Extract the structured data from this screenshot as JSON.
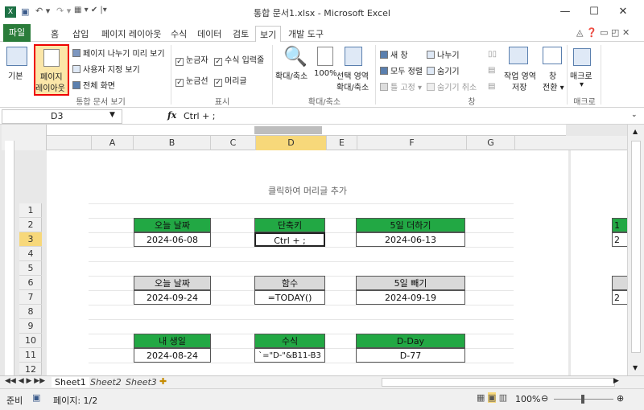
{
  "window": {
    "title": "통합 문서1.xlsx - Microsoft Excel"
  },
  "tabs": [
    "파일",
    "홈",
    "삽입",
    "페이지 레이아웃",
    "수식",
    "데이터",
    "검토",
    "보기",
    "개발 도구"
  ],
  "ribbon": {
    "normal": "기본",
    "page_layout_1": "페이지",
    "page_layout_2": "레이아웃",
    "page_break": "페이지 나누기 미리 보기",
    "custom_view": "사용자 지정 보기",
    "full_screen": "전체 화면",
    "group_views": "통합 문서 보기",
    "ruler": "눈금자",
    "formula_bar": "수식 입력줄",
    "gridlines": "눈금선",
    "headings": "머리글",
    "group_show": "표시",
    "zoom": "확대/축소",
    "zoom100": "100%",
    "zoom_sel_1": "선택 영역",
    "zoom_sel_2": "확대/축소",
    "group_zoom": "확대/축소",
    "new_window": "새 창",
    "arrange_all": "모두 정렬",
    "freeze": "틀 고정",
    "split": "나누기",
    "hide": "숨기기",
    "unhide": "숨기기 취소",
    "save_ws_1": "작업 영역",
    "save_ws_2": "저장",
    "switch_1": "창",
    "switch_2": "전환",
    "group_window": "창",
    "macro": "매크로",
    "group_macro": "매크로"
  },
  "formula": {
    "name": "D3",
    "fx": "fx",
    "value": "Ctrl + ;"
  },
  "columns": [
    "A",
    "B",
    "C",
    "D",
    "E",
    "F",
    "G"
  ],
  "rows": [
    "1",
    "2",
    "3",
    "4",
    "5",
    "6",
    "7",
    "8",
    "9",
    "10",
    "11",
    "12"
  ],
  "header_placeholder": "클릭하여 머리글 추가",
  "cells": {
    "b2": "오늘 날짜",
    "b3": "2024-06-08",
    "d2": "단축키",
    "d3": "Ctrl + ;",
    "f2": "5일 더하기",
    "f3": "2024-06-13",
    "b6": "오늘 날짜",
    "b7": "2024-09-24",
    "d6": "함수",
    "d7": "=TODAY()",
    "f6": "5일 빼기",
    "f7": "2024-09-19",
    "b10": "내 생일",
    "b11": "2024-08-24",
    "d10": "수식",
    "d11": "`=\"D-\"&B11-B3",
    "f10": "D-Day",
    "f11": "D-77",
    "h2": "1",
    "h3": "2",
    "h7": "2"
  },
  "sheets": [
    "Sheet1",
    "Sheet2",
    "Sheet3"
  ],
  "status": {
    "ready": "준비",
    "page": "페이지: 1/2",
    "zoom": "100%"
  }
}
